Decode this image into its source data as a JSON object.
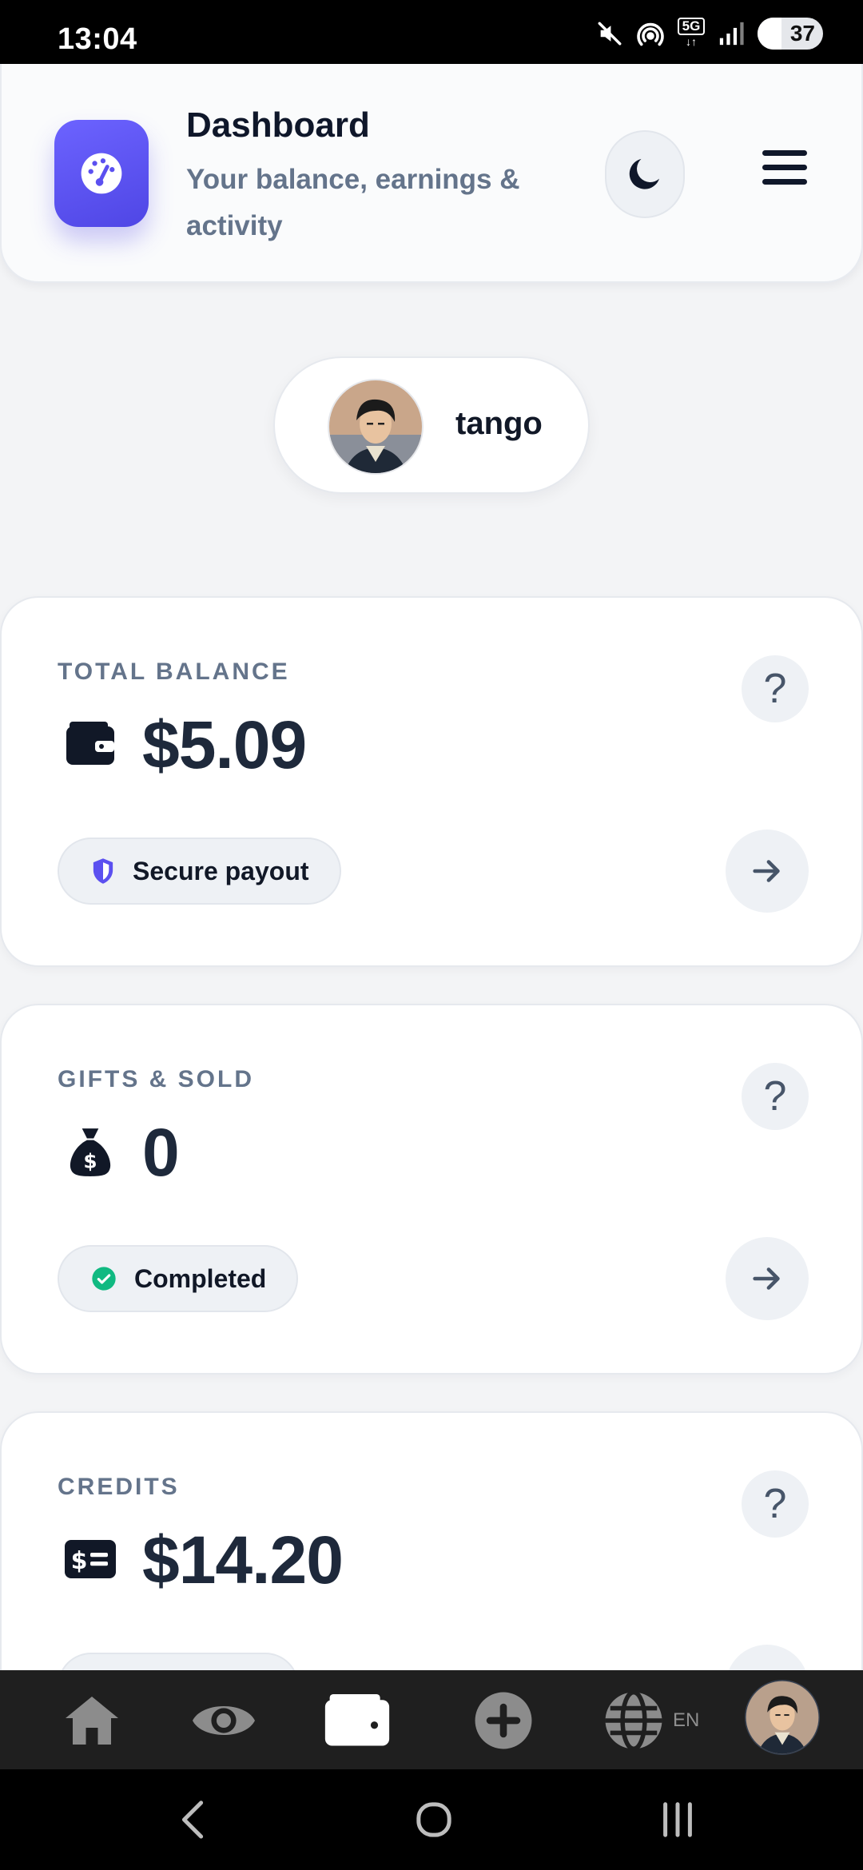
{
  "status_bar": {
    "time": "13:04",
    "network": "5G",
    "battery": "37"
  },
  "header": {
    "title": "Dashboard",
    "subtitle": "Your balance, earnings & activity",
    "logo_icon": "gauge-icon",
    "theme_icon": "moon-icon",
    "menu_icon": "hamburger-menu-icon"
  },
  "user": {
    "name": "tango"
  },
  "cards": [
    {
      "label": "TOTAL BALANCE",
      "value": "$5.09",
      "icon": "wallet-icon",
      "chip_label": "Secure payout",
      "chip_icon": "shield-icon"
    },
    {
      "label": "GIFTS & SOLD",
      "value": "0",
      "icon": "money-bag-icon",
      "chip_label": "Completed",
      "chip_icon": "check-circle-icon"
    },
    {
      "label": "CREDITS",
      "value": "$14.20",
      "icon": "money-bill-icon"
    }
  ],
  "help_symbol": "?",
  "bottom_nav": {
    "items": [
      "home-icon",
      "eye-icon",
      "wallet-icon",
      "plus-circle-icon",
      "globe-icon",
      "avatar"
    ],
    "language": "EN",
    "active": "wallet-icon"
  },
  "colors": {
    "accent": "#5b50f0",
    "success": "#10b981",
    "text_primary": "#1e293b",
    "text_muted": "#64748b"
  }
}
